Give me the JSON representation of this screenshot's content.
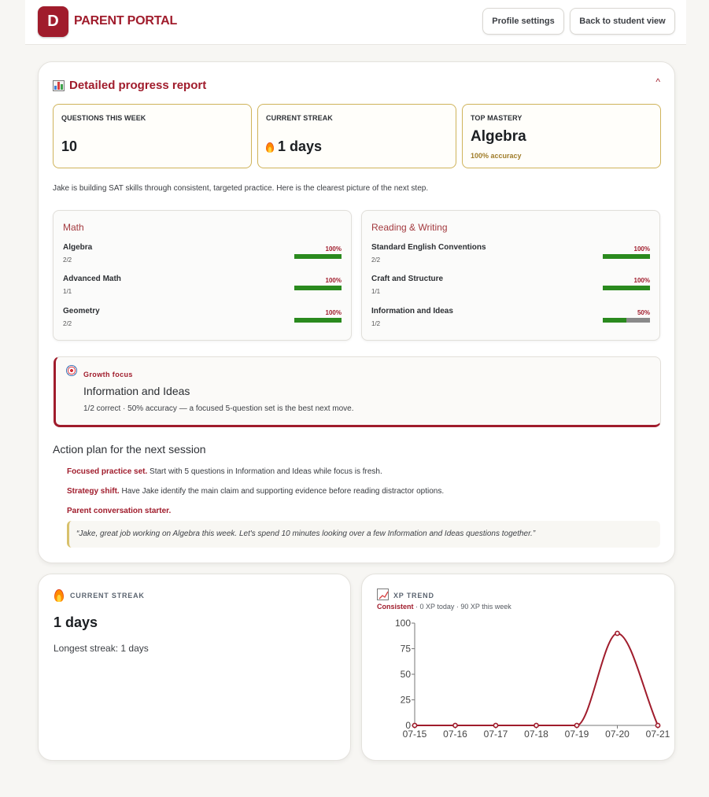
{
  "header": {
    "logo_letter": "D",
    "brand": "PARENT PORTAL",
    "profile_button": "Profile settings",
    "back_button": "Back to student view"
  },
  "report": {
    "title": "Detailed progress report",
    "collapse_glyph": "^",
    "stats": [
      {
        "label": "QUESTIONS THIS WEEK",
        "value": "10"
      },
      {
        "label": "CURRENT STREAK",
        "value": "1 days"
      },
      {
        "label": "TOP MASTERY",
        "value": "Algebra",
        "sub": "100% accuracy"
      }
    ],
    "summary": "Jake is building SAT skills through consistent, targeted practice. Here is the clearest picture of the next step.",
    "sections": [
      {
        "title": "Math",
        "skills": [
          {
            "name": "Algebra",
            "count": "2/2",
            "pct": "100%",
            "ratio": 1.0
          },
          {
            "name": "Advanced Math",
            "count": "1/1",
            "pct": "100%",
            "ratio": 1.0
          },
          {
            "name": "Geometry",
            "count": "2/2",
            "pct": "100%",
            "ratio": 1.0
          }
        ]
      },
      {
        "title": "Reading & Writing",
        "skills": [
          {
            "name": "Standard English Conventions",
            "count": "2/2",
            "pct": "100%",
            "ratio": 1.0
          },
          {
            "name": "Craft and Structure",
            "count": "1/1",
            "pct": "100%",
            "ratio": 1.0
          },
          {
            "name": "Information and Ideas",
            "count": "1/2",
            "pct": "50%",
            "ratio": 0.5
          }
        ]
      }
    ],
    "growth": {
      "tag": "Growth focus",
      "title": "Information and Ideas",
      "desc": "1/2 correct · 50% accuracy — a focused 5-question set is the best next move."
    },
    "plan": {
      "title": "Action plan for the next session",
      "items": [
        {
          "lead": "Focused practice set.",
          "text": " Start with 5 questions in Information and Ideas while focus is fresh."
        },
        {
          "lead": "Strategy shift.",
          "text": " Have Jake identify the main claim and supporting evidence before reading distractor options."
        },
        {
          "lead": "Parent conversation starter.",
          "text": ""
        }
      ],
      "quote": "“Jake, great job working on Algebra this week. Let's spend 10 minutes looking over a few Information and Ideas questions together.”"
    }
  },
  "streak_card": {
    "label": "CURRENT STREAK",
    "value": "1 days",
    "longest": "Longest streak: 1 days"
  },
  "xp_card": {
    "label": "XP TREND",
    "status": "Consistent",
    "detail": " · 0 XP today · 90 XP this week"
  },
  "colors": {
    "accent": "#a01c2c",
    "gold_border": "#cfb35a",
    "progress_green": "#2a8a1e"
  },
  "chart_data": {
    "type": "line",
    "title": "",
    "x": [
      "07-15",
      "07-16",
      "07-17",
      "07-18",
      "07-19",
      "07-20",
      "07-21"
    ],
    "series": [
      {
        "values": [
          0,
          0,
          0,
          0,
          0,
          90,
          0
        ]
      }
    ],
    "ylim": [
      0,
      100
    ],
    "yticks": [
      0,
      25,
      50,
      75,
      100
    ],
    "color": "#a01c2c",
    "grid": false
  }
}
